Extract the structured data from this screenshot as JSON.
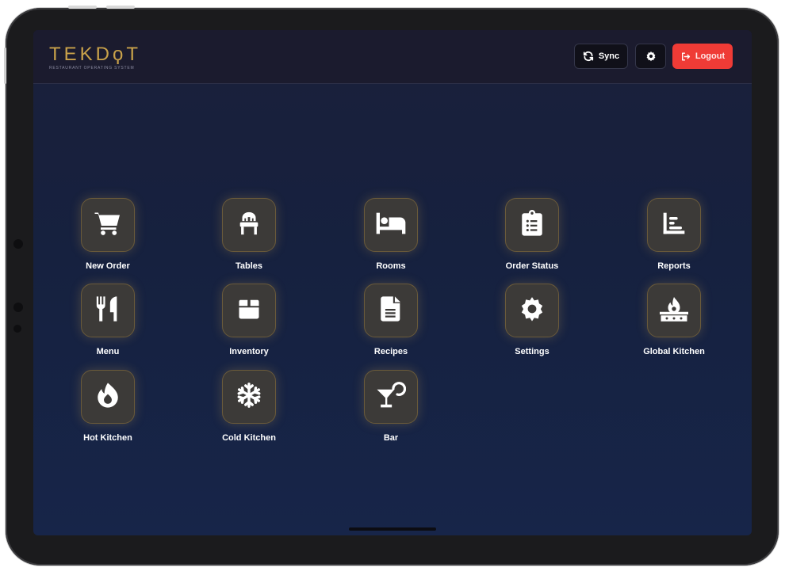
{
  "brand": {
    "logo": "TEKDϙT",
    "subtitle": "RESTAURANT OPERATING SYSTEM",
    "accent": "#c9a24a"
  },
  "header": {
    "sync_label": "Sync",
    "settings_icon": "gear-icon",
    "logout_label": "Logout",
    "logout_color": "#ef3b36"
  },
  "tiles": [
    {
      "label": "New Order",
      "icon": "cart-icon"
    },
    {
      "label": "Tables",
      "icon": "chair-icon"
    },
    {
      "label": "Rooms",
      "icon": "bed-icon"
    },
    {
      "label": "Order Status",
      "icon": "clipboard-list-icon"
    },
    {
      "label": "Reports",
      "icon": "chart-icon"
    },
    {
      "label": "Menu",
      "icon": "utensils-icon"
    },
    {
      "label": "Inventory",
      "icon": "box-icon"
    },
    {
      "label": "Recipes",
      "icon": "document-icon"
    },
    {
      "label": "Settings",
      "icon": "gear-icon"
    },
    {
      "label": "Global Kitchen",
      "icon": "stove-fire-icon"
    },
    {
      "label": "Hot Kitchen",
      "icon": "fire-icon"
    },
    {
      "label": "Cold Kitchen",
      "icon": "snowflake-icon"
    },
    {
      "label": "Bar",
      "icon": "cocktail-icon"
    }
  ]
}
